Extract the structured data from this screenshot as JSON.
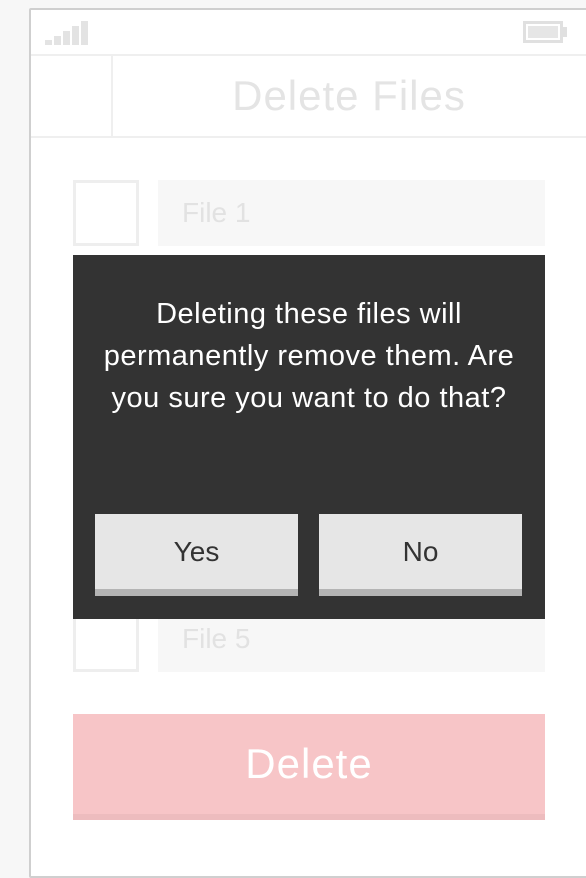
{
  "header": {
    "title": "Delete Files"
  },
  "files": [
    {
      "label": "File 1"
    },
    {
      "label": "File 5"
    }
  ],
  "dialog": {
    "message": "Deleting these files will permanently remove them. Are you sure you want to do that?",
    "yes_label": "Yes",
    "no_label": "No"
  },
  "delete_button": {
    "label": "Delete"
  },
  "colors": {
    "delete_bg": "#f7c5c7",
    "dialog_bg": "#333333",
    "dialog_button_bg": "#e6e6e6"
  },
  "icons": {
    "signal": "signal-icon",
    "battery": "battery-icon"
  }
}
